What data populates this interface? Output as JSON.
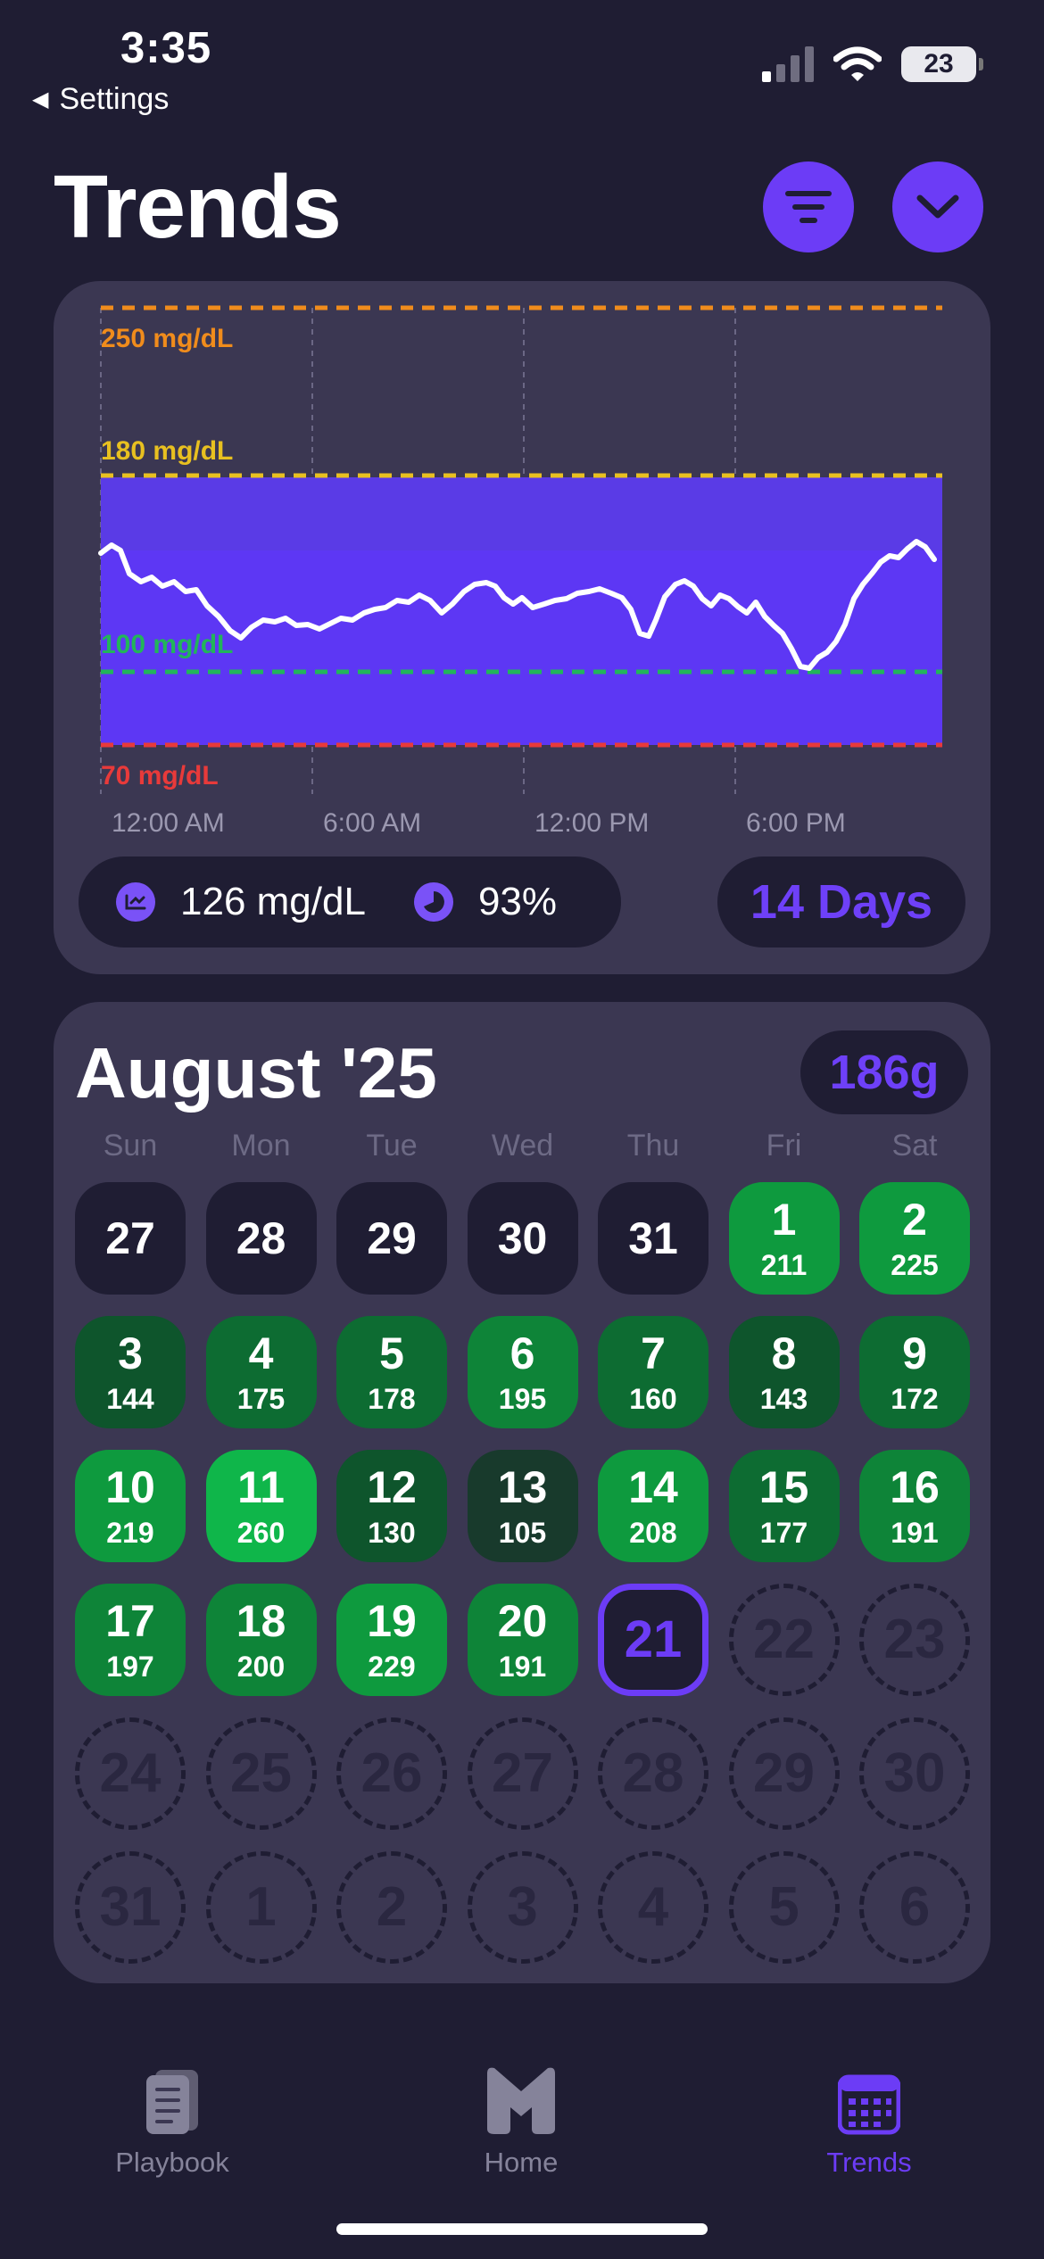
{
  "status": {
    "time": "3:35",
    "back_label": "Settings",
    "battery": "23"
  },
  "header": {
    "title": "Trends",
    "filter_icon": "filter-lines-icon",
    "chevron_icon": "chevron-down-icon"
  },
  "chart": {
    "thresholds": [
      {
        "label": "250 mg/dL",
        "color": "#f08c1c"
      },
      {
        "label": "180 mg/dL",
        "color": "#e8c020"
      },
      {
        "label": "100 mg/dL",
        "color": "#22b55a"
      },
      {
        "label": "70 mg/dL",
        "color": "#e83a3a"
      }
    ],
    "time_labels": [
      "12:00 AM",
      "6:00 AM",
      "12:00 PM",
      "6:00 PM"
    ],
    "avg_value": "126 mg/dL",
    "pct_value": "93%",
    "range_label": "14 Days"
  },
  "calendar": {
    "month_title": "August '25",
    "total": "186g",
    "weekdays": [
      "Sun",
      "Mon",
      "Tue",
      "Wed",
      "Thu",
      "Fri",
      "Sat"
    ],
    "prev_days": [
      "27",
      "28",
      "29",
      "30",
      "31"
    ],
    "days": [
      {
        "n": "1",
        "v": "211"
      },
      {
        "n": "2",
        "v": "225"
      },
      {
        "n": "3",
        "v": "144"
      },
      {
        "n": "4",
        "v": "175"
      },
      {
        "n": "5",
        "v": "178"
      },
      {
        "n": "6",
        "v": "195"
      },
      {
        "n": "7",
        "v": "160"
      },
      {
        "n": "8",
        "v": "143"
      },
      {
        "n": "9",
        "v": "172"
      },
      {
        "n": "10",
        "v": "219"
      },
      {
        "n": "11",
        "v": "260"
      },
      {
        "n": "12",
        "v": "130"
      },
      {
        "n": "13",
        "v": "105"
      },
      {
        "n": "14",
        "v": "208"
      },
      {
        "n": "15",
        "v": "177"
      },
      {
        "n": "16",
        "v": "191"
      },
      {
        "n": "17",
        "v": "197"
      },
      {
        "n": "18",
        "v": "200"
      },
      {
        "n": "19",
        "v": "229"
      },
      {
        "n": "20",
        "v": "191"
      }
    ],
    "today": "21",
    "future_days": [
      "22",
      "23",
      "24",
      "25",
      "26",
      "27",
      "28",
      "29",
      "30",
      "31",
      "1",
      "2",
      "3",
      "4",
      "5",
      "6"
    ]
  },
  "tabbar": {
    "items": [
      "Playbook",
      "Home",
      "Trends"
    ],
    "active": "Trends"
  }
}
